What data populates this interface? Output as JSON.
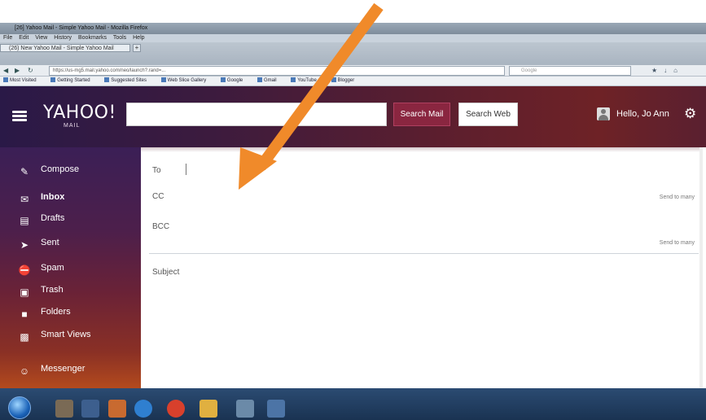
{
  "browser": {
    "title": "[26] Yahoo Mail - Simple Yahoo Mail - Mozilla Firefox",
    "menu": [
      "File",
      "Edit",
      "View",
      "History",
      "Bookmarks",
      "Tools",
      "Help"
    ],
    "tab_label": "(26) New Yahoo Mail - Simple Yahoo Mail",
    "url": "https://us-mg5.mail.yahoo.com/neo/launch?.rand=...",
    "search_placeholder": "Google",
    "bookmarks": [
      "Most Visited",
      "Getting Started",
      "Suggested Sites",
      "Web Slice Gallery",
      "Google",
      "Gmail",
      "YouTube",
      "Blogger"
    ]
  },
  "header": {
    "logo": "YAHOO!",
    "logo_sub": "MAIL",
    "search_placeholder": "",
    "search_mail_label": "Search Mail",
    "search_web_label": "Search Web",
    "user_name": "Hello, Jo Ann",
    "settings_icon": "gear-icon"
  },
  "sidebar": {
    "items": [
      {
        "label": "Compose",
        "icon": "compose-icon"
      },
      {
        "label": "Inbox",
        "icon": "inbox-icon"
      },
      {
        "label": "Drafts",
        "icon": "drafts-icon"
      },
      {
        "label": "Sent",
        "icon": "sent-icon"
      },
      {
        "label": "Spam",
        "icon": "spam-icon"
      },
      {
        "label": "Trash",
        "icon": "trash-icon"
      },
      {
        "label": "Folders",
        "icon": "folder-icon"
      },
      {
        "label": "Smart Views",
        "icon": "smart-views-icon"
      },
      {
        "label": "Messenger",
        "icon": "messenger-icon"
      }
    ]
  },
  "compose": {
    "to_label": "To",
    "cc_label": "CC",
    "bcc_label": "BCC",
    "cc_link": "Send to many",
    "bcc_link": "Send to many",
    "subject_label": "Subject"
  },
  "taskbar": {
    "time": "",
    "date": ""
  },
  "colors": {
    "header_dark": "#2a1947",
    "header_red": "#6e2226",
    "search_mail_btn": "#8a2640",
    "arrow": "#f08a2a",
    "sidebar_bottom": "#b34a1d"
  }
}
